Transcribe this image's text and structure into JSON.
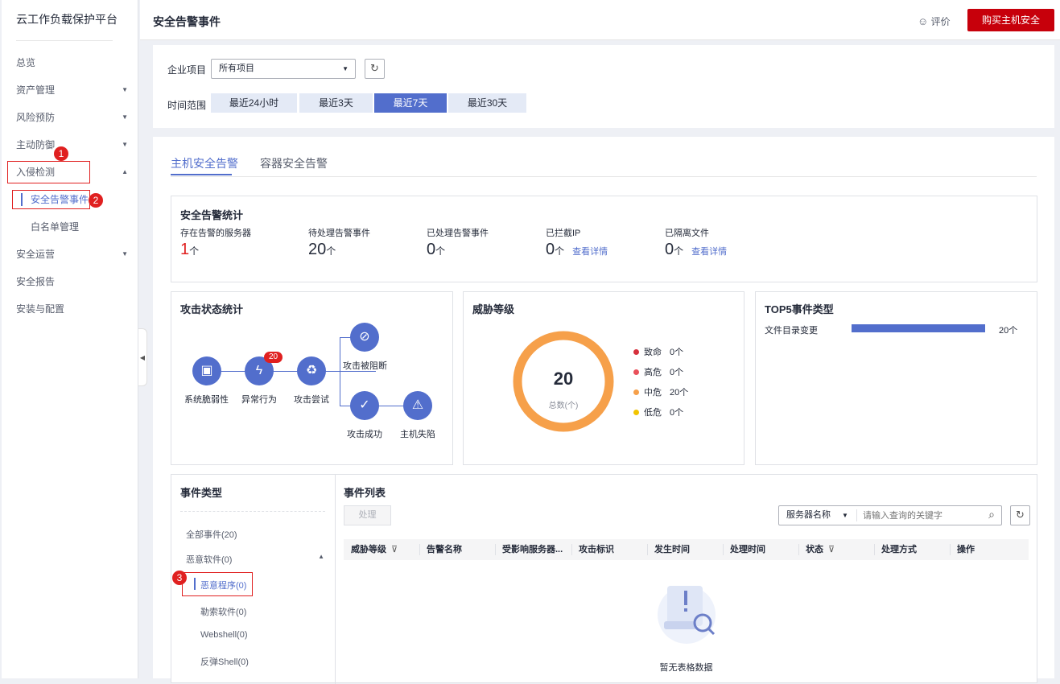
{
  "sidebar": {
    "title": "云工作负载保护平台",
    "items": [
      {
        "label": "总览"
      },
      {
        "label": "资产管理"
      },
      {
        "label": "风险预防"
      },
      {
        "label": "主动防御"
      },
      {
        "label": "入侵检测"
      },
      {
        "label": "安全告警事件"
      },
      {
        "label": "白名单管理"
      },
      {
        "label": "安全运营"
      },
      {
        "label": "安全报告"
      },
      {
        "label": "安装与配置"
      }
    ],
    "callouts": [
      "1",
      "2",
      "3"
    ]
  },
  "header": {
    "title": "安全告警事件",
    "rate_label": "评价",
    "buy_label": "购买主机安全"
  },
  "filters": {
    "project_label": "企业项目",
    "project_value": "所有项目",
    "time_label": "时间范围",
    "time_options": [
      "最近24小时",
      "最近3天",
      "最近7天",
      "最近30天"
    ],
    "time_selected": "最近7天"
  },
  "tabs": [
    "主机安全告警",
    "容器安全告警"
  ],
  "stats": {
    "title": "安全告警统计",
    "items": [
      {
        "label": "存在告警的服务器",
        "value": "1",
        "unit": "个"
      },
      {
        "label": "待处理告警事件",
        "value": "20",
        "unit": "个"
      },
      {
        "label": "已处理告警事件",
        "value": "0",
        "unit": "个"
      },
      {
        "label": "已拦截IP",
        "value": "0",
        "unit": "个",
        "link": "查看详情"
      },
      {
        "label": "已隔离文件",
        "value": "0",
        "unit": "个",
        "link": "查看详情"
      }
    ]
  },
  "attack": {
    "title": "攻击状态统计",
    "nodes": [
      "系统脆弱性",
      "异常行为",
      "攻击尝试",
      "攻击被阻断",
      "攻击成功",
      "主机失陷"
    ],
    "abnormal_badge": "20"
  },
  "threat": {
    "title": "威胁等级",
    "total": "20",
    "total_label": "总数(个)",
    "levels": [
      {
        "label": "致命",
        "count": "0个",
        "color": "#d6303d"
      },
      {
        "label": "高危",
        "count": "0个",
        "color": "#e9505a"
      },
      {
        "label": "中危",
        "count": "20个",
        "color": "#f6a04a"
      },
      {
        "label": "低危",
        "count": "0个",
        "color": "#f2c400"
      }
    ],
    "ring_color": "#f6a04a"
  },
  "top5": {
    "title": "TOP5事件类型",
    "items": [
      {
        "label": "文件目录变更",
        "value": "20个",
        "fraction": 1
      }
    ]
  },
  "event_types": {
    "title": "事件类型",
    "all": "全部事件(20)",
    "malware": "恶意软件(0)",
    "children": [
      "恶意程序(0)",
      "勒索软件(0)",
      "Webshell(0)",
      "反弹Shell(0)"
    ]
  },
  "event_list": {
    "title": "事件列表",
    "process_btn": "处理",
    "search_field": "服务器名称",
    "search_placeholder": "请输入查询的关键字",
    "columns": [
      "威胁等级",
      "告警名称",
      "受影响服务器...",
      "攻击标识",
      "发生时间",
      "处理时间",
      "状态",
      "处理方式",
      "操作"
    ],
    "empty_text": "暂无表格数据"
  },
  "accent_color": "#526ecc",
  "brand_color": "#c7000b"
}
